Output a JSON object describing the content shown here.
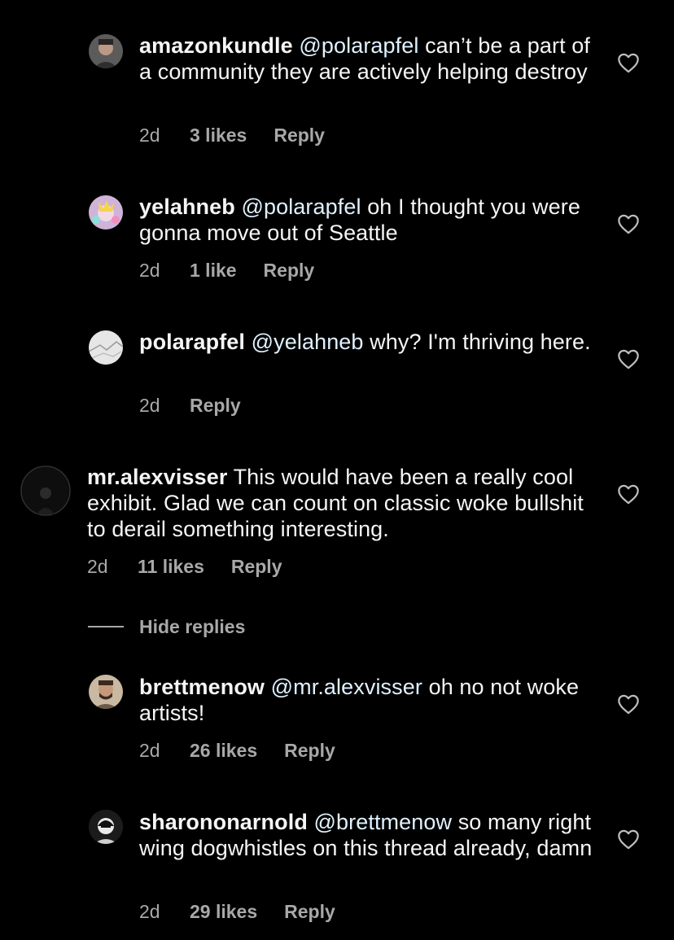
{
  "comments": [
    {
      "username": "amazonkundle",
      "mention": "@polarapfel",
      "text": "can’t be a part of a community they are actively helping destroy",
      "time": "2d",
      "likes": "3 likes",
      "reply": "Reply"
    },
    {
      "username": "yelahneb",
      "mention": "@polarapfel",
      "text": "oh I thought you were gonna move out of Seattle",
      "time": "2d",
      "likes": "1 like",
      "reply": "Reply"
    },
    {
      "username": "polarapfel",
      "mention": "@yelahneb",
      "text": "why? I'm thriving here.",
      "time": "2d",
      "likes": "",
      "reply": "Reply"
    },
    {
      "username": "mr.alexvisser",
      "mention": "",
      "text": "This would have been a really cool exhibit. Glad we can count on classic woke bullshit to derail something interesting.",
      "time": "2d",
      "likes": "11 likes",
      "reply": "Reply"
    },
    {
      "username": "brettmenow",
      "mention": "@mr.alexvisser",
      "text": "oh no not woke artists!",
      "time": "2d",
      "likes": "26 likes",
      "reply": "Reply"
    },
    {
      "username": "sharononarnold",
      "mention": "@brettmenow",
      "text": "so many right wing dogwhistles on this thread already, damn",
      "time": "2d",
      "likes": "29 likes",
      "reply": "Reply"
    }
  ],
  "hide_replies": "Hide replies",
  "icons": {
    "like": "heart-outline-icon"
  },
  "colors": {
    "background": "#000000",
    "meta": "#a8a8a8",
    "mention": "#e0f1ff"
  }
}
